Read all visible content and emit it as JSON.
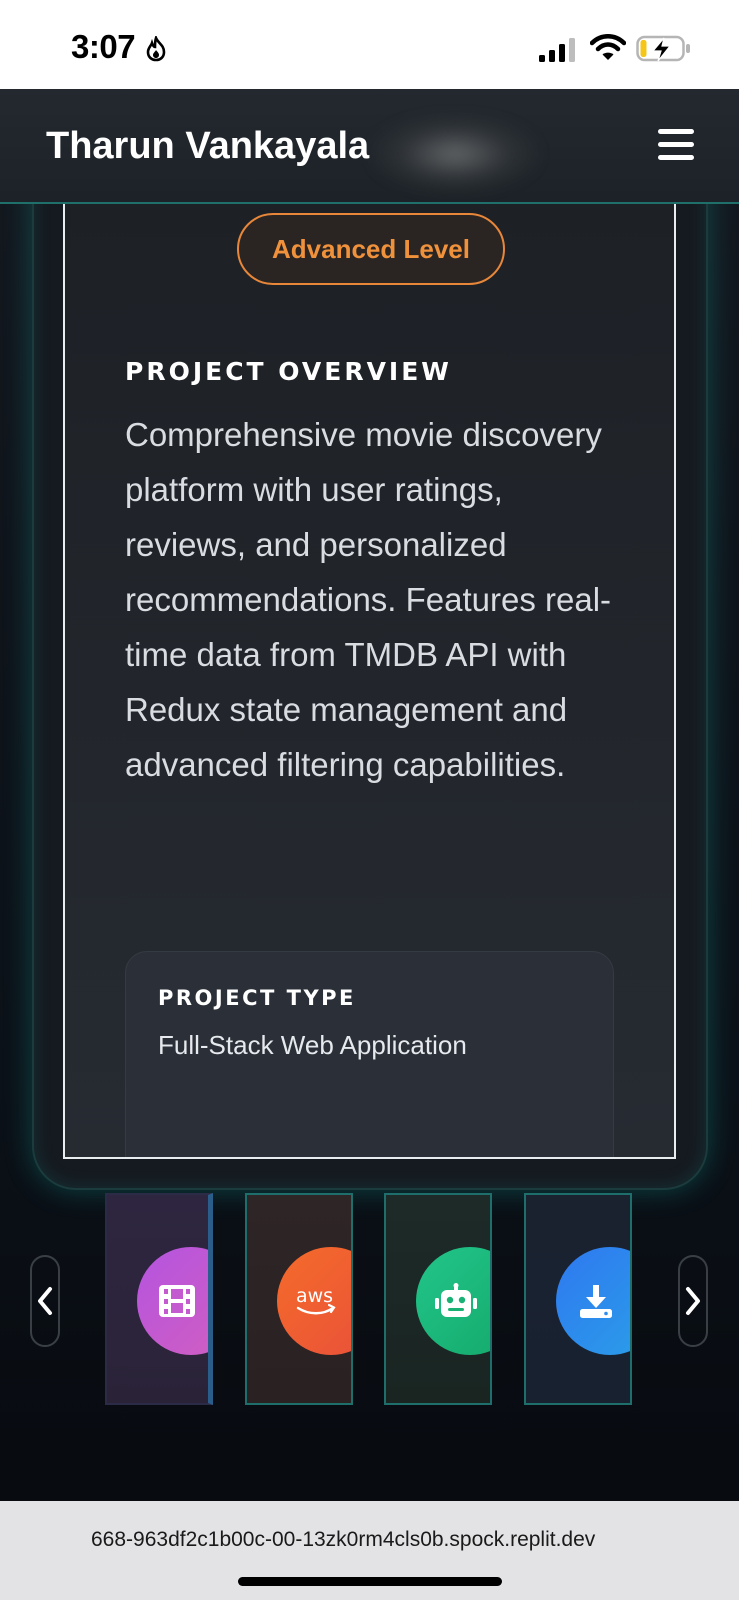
{
  "status_bar": {
    "time": "3:07"
  },
  "header": {
    "brand": "Tharun Vankayala"
  },
  "project": {
    "level_badge": "Advanced Level",
    "overview_title": "PROJECT OVERVIEW",
    "overview_text": "Comprehensive movie discovery platform with user ratings, reviews, and personalized recommendations. Features real-time data from TMDB API with Redux state management and advanced filtering capabilities.",
    "type_label": "PROJECT TYPE",
    "type_value": "Full-Stack Web Application"
  },
  "carousel": {
    "thumbnails": [
      {
        "icon": "film-icon",
        "color": "#c153d6"
      },
      {
        "icon": "aws-icon",
        "color": "#f0592f"
      },
      {
        "icon": "robot-icon",
        "color": "#1fbf7a"
      },
      {
        "icon": "download-icon",
        "color": "#2f8cf0"
      }
    ]
  },
  "browser": {
    "url": "668-963df2c1b00c-00-13zk0rm4cls0b.spock.replit.dev"
  },
  "colors": {
    "accent_teal": "#1e6f6c",
    "badge_orange": "#f0913c"
  }
}
